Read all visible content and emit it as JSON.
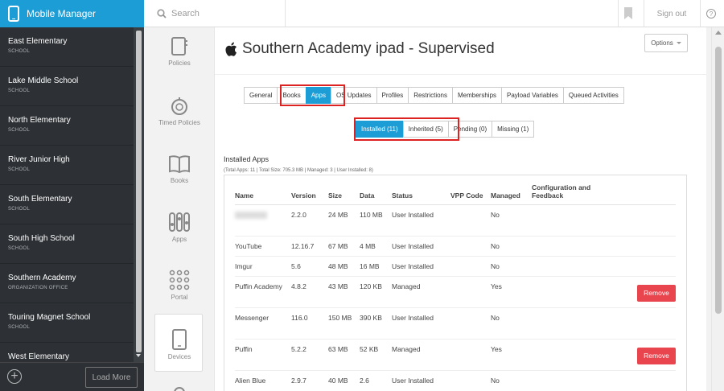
{
  "brand": {
    "title": "Mobile Manager",
    "icon": "phone-icon"
  },
  "search": {
    "placeholder": "Search",
    "icon": "search-icon"
  },
  "header": {
    "signout": "Sign out",
    "help_icon": "help-icon",
    "help_glyph": "?"
  },
  "sidebar": {
    "schools": [
      {
        "name": "East Elementary",
        "type": "SCHOOL"
      },
      {
        "name": "Lake Middle School",
        "type": "SCHOOL"
      },
      {
        "name": "North Elementary",
        "type": "SCHOOL"
      },
      {
        "name": "River Junior High",
        "type": "SCHOOL"
      },
      {
        "name": "South Elementary",
        "type": "SCHOOL"
      },
      {
        "name": "South High School",
        "type": "SCHOOL"
      },
      {
        "name": "Southern Academy",
        "type": "ORGANIZATION OFFICE"
      },
      {
        "name": "Touring Magnet School",
        "type": "SCHOOL"
      },
      {
        "name": "West Elementary",
        "type": ""
      }
    ],
    "add_glyph": "+",
    "load_more": "Load More"
  },
  "rail": {
    "items": [
      {
        "label": "Policies",
        "icon": "policies-icon"
      },
      {
        "label": "Timed Policies",
        "icon": "timed-policies-icon"
      },
      {
        "label": "Books",
        "icon": "books-icon"
      },
      {
        "label": "Apps",
        "icon": "apps-icon"
      },
      {
        "label": "Portal",
        "icon": "portal-icon"
      },
      {
        "label": "Devices",
        "icon": "devices-icon"
      }
    ]
  },
  "device": {
    "title": "Southern Academy ipad - Supervised",
    "options": "Options"
  },
  "tabs": [
    "General",
    "Books",
    "Apps",
    "OS Updates",
    "Profiles",
    "Restrictions",
    "Memberships",
    "Payload Variables",
    "Queued Activities"
  ],
  "active_tab": "Apps",
  "subtabs": [
    "Installed (11)",
    "Inherited (5)",
    "Pending (0)",
    "Missing (1)"
  ],
  "active_subtab": "Installed (11)",
  "installed": {
    "title": "Installed Apps",
    "summary": "(Total Apps: 11 | Total Size: 705.3 MB | Managed: 3 | User Installed: 8)",
    "columns": [
      "Name",
      "Version",
      "Size",
      "Data",
      "Status",
      "VPP Code",
      "Managed",
      "Configuration and Feedback"
    ],
    "rows": [
      {
        "name": "",
        "version": "2.2.0",
        "size": "24 MB",
        "data": "110 MB",
        "status": "User Installed",
        "vpp": "",
        "managed": "No",
        "remove": ""
      },
      {
        "name": "YouTube",
        "version": "12.16.7",
        "size": "67 MB",
        "data": "4 MB",
        "status": "User Installed",
        "vpp": "",
        "managed": "No",
        "remove": ""
      },
      {
        "name": "Imgur",
        "version": "5.6",
        "size": "48 MB",
        "data": "16 MB",
        "status": "User Installed",
        "vpp": "",
        "managed": "No",
        "remove": ""
      },
      {
        "name": "Puffin Academy",
        "version": "4.8.2",
        "size": "43 MB",
        "data": "120 KB",
        "status": "Managed",
        "vpp": "",
        "managed": "Yes",
        "remove": "Remove"
      },
      {
        "name": "Messenger",
        "version": "116.0",
        "size": "150 MB",
        "data": "390 KB",
        "status": "User Installed",
        "vpp": "",
        "managed": "No",
        "remove": ""
      },
      {
        "name": "Puffin",
        "version": "5.2.2",
        "size": "63 MB",
        "data": "52 KB",
        "status": "Managed",
        "vpp": "",
        "managed": "Yes",
        "remove": "Remove"
      },
      {
        "name": "Alien Blue",
        "version": "2.9.7",
        "size": "40 MB",
        "data": "2.6",
        "status": "User Installed",
        "vpp": "",
        "managed": "No",
        "remove": ""
      }
    ]
  },
  "colors": {
    "accent": "#1d9dd6",
    "sidebar": "#2d3135",
    "remove": "#e8454f",
    "highlight": "#dd2222"
  }
}
